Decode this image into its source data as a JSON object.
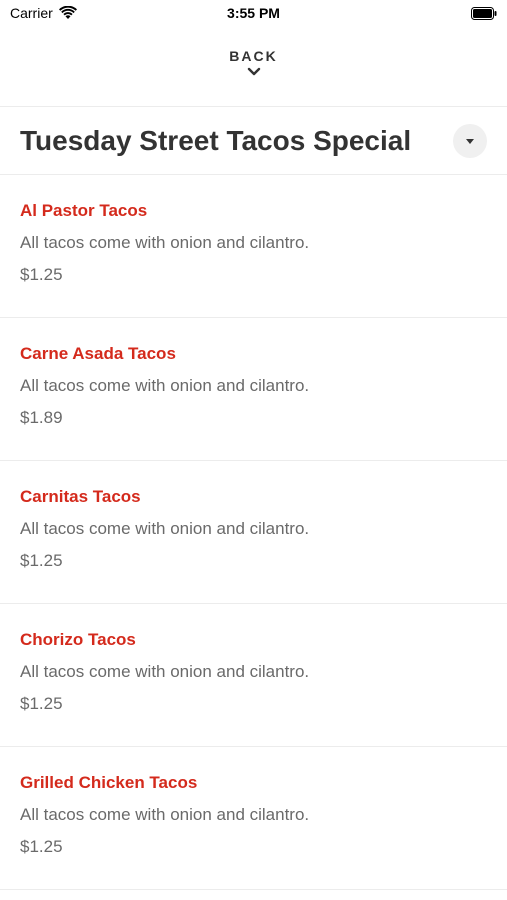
{
  "status_bar": {
    "carrier": "Carrier",
    "time": "3:55 PM"
  },
  "nav": {
    "back_label": "BACK"
  },
  "section": {
    "title": "Tuesday Street Tacos Special"
  },
  "menu_items": [
    {
      "name": "Al Pastor Tacos",
      "description": "All tacos come with onion and cilantro.",
      "price": "$1.25"
    },
    {
      "name": "Carne Asada Tacos",
      "description": "All tacos come with onion and cilantro.",
      "price": "$1.89"
    },
    {
      "name": "Carnitas Tacos",
      "description": "All tacos come with onion and cilantro.",
      "price": "$1.25"
    },
    {
      "name": "Chorizo Tacos",
      "description": "All tacos come with onion and cilantro.",
      "price": "$1.25"
    },
    {
      "name": "Grilled Chicken Tacos",
      "description": "All tacos come with onion and cilantro.",
      "price": "$1.25"
    }
  ],
  "colors": {
    "accent": "#d42a1c",
    "text": "#333333",
    "muted": "#6a6a6a"
  }
}
